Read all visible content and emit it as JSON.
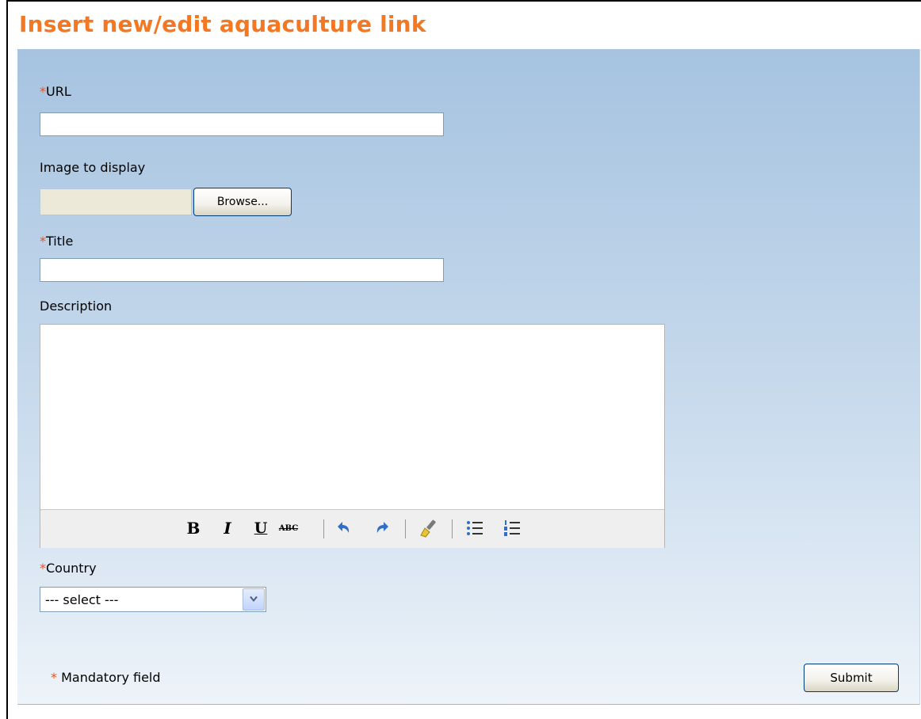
{
  "page": {
    "title": "Insert new/edit aquaculture link"
  },
  "required_marker": "*",
  "colors": {
    "accent": "#f47721",
    "required": "#e8541c",
    "panel_top": "#a6c3e0",
    "panel_bottom": "#edf3f9"
  },
  "form": {
    "url": {
      "label": "URL",
      "value": "",
      "required": true
    },
    "image": {
      "label": "Image to display",
      "browse_label": "Browse...",
      "value": ""
    },
    "title": {
      "label": "Title",
      "value": "",
      "required": true
    },
    "description": {
      "label": "Description",
      "value": "",
      "toolbar": {
        "bold": "B",
        "italic": "I",
        "underline": "U",
        "strikethrough": "ABC",
        "icons": [
          "undo-icon",
          "redo-icon",
          "cleanup-brush-icon",
          "bullet-list-icon",
          "numbered-list-icon"
        ]
      }
    },
    "country": {
      "label": "Country",
      "selected": "--- select ---",
      "required": true,
      "icon": "chevron-down-icon"
    },
    "mandatory_note": "Mandatory field",
    "submit_label": "Submit"
  }
}
